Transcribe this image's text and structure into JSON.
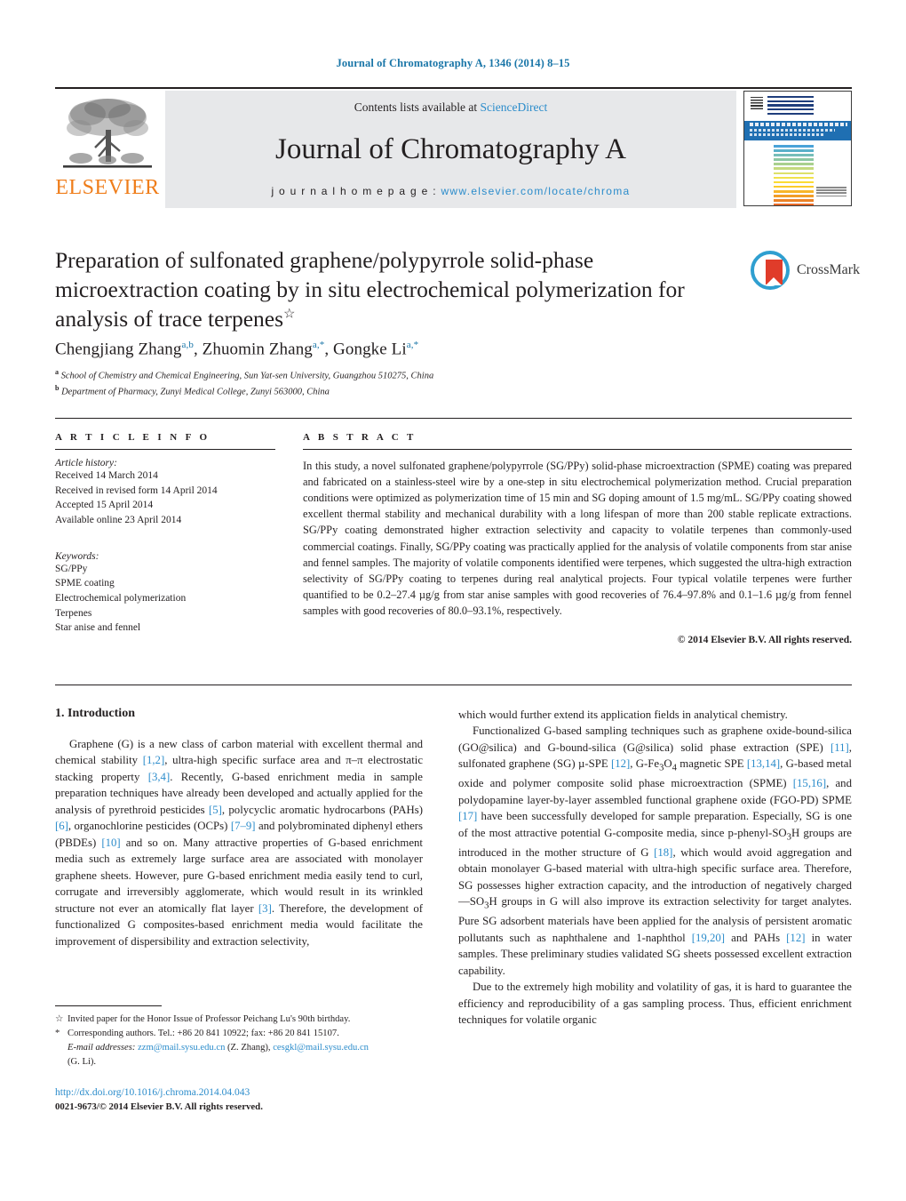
{
  "running_head": "Journal of Chromatography A, 1346 (2014) 8–15",
  "masthead": {
    "publisher_logo_text": "ELSEVIER",
    "contents_prefix": "Contents lists available at ",
    "contents_link": "ScienceDirect",
    "journal_title": "Journal of Chromatography A",
    "homepage_prefix": "j o u r n a l   h o m e p a g e :   ",
    "homepage_url": "www.elsevier.com/locate/chroma",
    "cover_alt": "journal-cover-thumbnail",
    "spectrum_colors": [
      "#4aa3d8",
      "#5ab0c9",
      "#76bdb9",
      "#8cc6a2",
      "#a9d08e",
      "#c4d97e",
      "#dde06a",
      "#f1e24a",
      "#fbdc33",
      "#fbcb2a",
      "#f7b62a",
      "#f29d28",
      "#ec8226",
      "#e76a28",
      "#e2542a",
      "#dd4430"
    ]
  },
  "article": {
    "title": "Preparation of sulfonated graphene/polypyrrole solid-phase microextraction coating by in situ electrochemical polymerization for analysis of trace terpenes",
    "title_footnote_mark": "☆",
    "crossmark_label": "CrossMark",
    "authors": "Chengjiang Zhang<a,b>, Zhuomin Zhang<a,*>, Gongke Li<a,*>",
    "authors_parts": [
      {
        "name": "Chengjiang Zhang",
        "sup": "a,b",
        "sep": ", "
      },
      {
        "name": "Zhuomin Zhang",
        "sup": "a,*",
        "sep": ", "
      },
      {
        "name": "Gongke Li",
        "sup": "a,*",
        "sep": ""
      }
    ],
    "affiliations": [
      {
        "mark": "a",
        "text": "School of Chemistry and Chemical Engineering, Sun Yat-sen University, Guangzhou 510275, China"
      },
      {
        "mark": "b",
        "text": "Department of Pharmacy, Zunyi Medical College, Zunyi 563000, China"
      }
    ]
  },
  "article_info": {
    "heading": "A R T I C L E   I N F O",
    "history_label": "Article history:",
    "history": [
      "Received 14 March 2014",
      "Received in revised form 14 April 2014",
      "Accepted 15 April 2014",
      "Available online 23 April 2014"
    ],
    "keywords_label": "Keywords:",
    "keywords": [
      "SG/PPy",
      "SPME coating",
      "Electrochemical polymerization",
      "Terpenes",
      "Star anise and fennel"
    ]
  },
  "abstract": {
    "heading": "A B S T R A C T",
    "text": "In this study, a novel sulfonated graphene/polypyrrole (SG/PPy) solid-phase microextraction (SPME) coating was prepared and fabricated on a stainless-steel wire by a one-step in situ electrochemical polymerization method. Crucial preparation conditions were optimized as polymerization time of 15 min and SG doping amount of 1.5 mg/mL. SG/PPy coating showed excellent thermal stability and mechanical durability with a long lifespan of more than 200 stable replicate extractions. SG/PPy coating demonstrated higher extraction selectivity and capacity to volatile terpenes than commonly-used commercial coatings. Finally, SG/PPy coating was practically applied for the analysis of volatile components from star anise and fennel samples. The majority of volatile components identified were terpenes, which suggested the ultra-high extraction selectivity of SG/PPy coating to terpenes during real analytical projects. Four typical volatile terpenes were further quantified to be 0.2–27.4 µg/g from star anise samples with good recoveries of 76.4–97.8% and 0.1–1.6 µg/g from fennel samples with good recoveries of 80.0–93.1%, respectively.",
    "copyright": "© 2014 Elsevier B.V. All rights reserved."
  },
  "body": {
    "section_heading": "1.  Introduction",
    "left_paragraphs": [
      "Graphene (G) is a new class of carbon material with excellent thermal and chemical stability [1,2], ultra-high specific surface area and π–π electrostatic stacking property [3,4]. Recently, G-based enrichment media in sample preparation techniques have already been developed and actually applied for the analysis of pyrethroid pesticides [5], polycyclic aromatic hydrocarbons (PAHs) [6], organochlorine pesticides (OCPs) [7–9] and polybrominated diphenyl ethers (PBDEs) [10] and so on. Many attractive properties of G-based enrichment media such as extremely large surface area are associated with monolayer graphene sheets. However, pure G-based enrichment media easily tend to curl, corrugate and irreversibly agglomerate, which would result in its wrinkled structure not ever an atomically flat layer [3]. Therefore, the development of functionalized G composites-based enrichment media would facilitate the improvement of dispersibility and extraction selectivity,"
    ],
    "right_paragraphs": [
      "which would further extend its application fields in analytical chemistry.",
      "Functionalized G-based sampling techniques such as graphene oxide-bound-silica (GO@silica) and G-bound-silica (G@silica) solid phase extraction (SPE) [11], sulfonated graphene (SG) µ-SPE [12], G-Fe3O4 magnetic SPE [13,14], G-based metal oxide and polymer composite solid phase microextraction (SPME) [15,16], and polydopamine layer-by-layer assembled functional graphene oxide (FGO-PD) SPME [17] have been successfully developed for sample preparation. Especially, SG is one of the most attractive potential G-composite media, since p-phenyl-SO3H groups are introduced in the mother structure of G [18], which would avoid aggregation and obtain monolayer G-based material with ultra-high specific surface area. Therefore, SG possesses higher extraction capacity, and the introduction of negatively charged —SO3H groups in G will also improve its extraction selectivity for target analytes. Pure SG adsorbent materials have been applied for the analysis of persistent aromatic pollutants such as naphthalene and 1-naphthol [19,20] and PAHs [12] in water samples. These preliminary studies validated SG sheets possessed excellent extraction capability.",
      "Due to the extremely high mobility and volatility of gas, it is hard to guarantee the efficiency and reproducibility of a gas sampling process. Thus, efficient enrichment techniques for volatile organic"
    ]
  },
  "footnotes": [
    {
      "mark": "☆",
      "text": "Invited paper for the Honor Issue of Professor Peichang Lu's 90th birthday."
    },
    {
      "mark": "*",
      "text": "Corresponding authors. Tel.: +86 20 841 10922; fax: +86 20 841 15107."
    }
  ],
  "email_note": {
    "label": "E-mail addresses:",
    "email1": "zzm@mail.sysu.edu.cn",
    "author1": " (Z. Zhang), ",
    "email2": "cesgkl@mail.sysu.edu.cn",
    "author2": "(G. Li)."
  },
  "footer": {
    "doi": "http://dx.doi.org/10.1016/j.chroma.2014.04.043",
    "issn_line": "0021-9673/© 2014 Elsevier B.V. All rights reserved."
  },
  "colors": {
    "link_blue": "#2b8ccb",
    "header_blue": "#1a76a8",
    "elsevier_orange": "#ef7d1a",
    "crossmark_red": "#e03c2a",
    "crossmark_blue": "#2f9fd0"
  }
}
